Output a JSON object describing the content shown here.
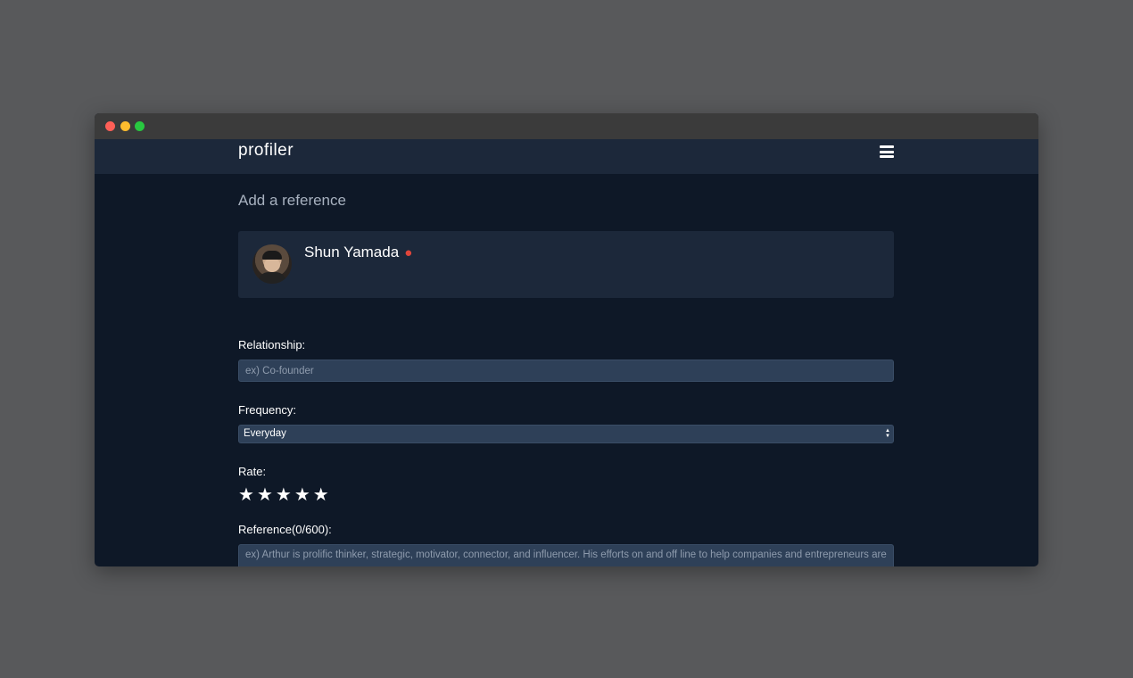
{
  "navbar": {
    "brand": "profiler"
  },
  "page": {
    "title": "Add a reference"
  },
  "profile": {
    "name": "Shun Yamada",
    "emoji_icon": "goblin-mask-icon"
  },
  "form": {
    "relationship": {
      "label": "Relationship:",
      "placeholder": "ex) Co-founder"
    },
    "frequency": {
      "label": "Frequency:",
      "selected": "Everyday"
    },
    "rate": {
      "label": "Rate:",
      "stars": 5,
      "value": 5
    },
    "reference": {
      "label": "Reference(0/600):",
      "placeholder": "ex) Arthur is prolific thinker, strategic, motivator, connector, and influencer. His efforts on and off line to help companies and entrepreneurs are"
    }
  },
  "colors": {
    "backdrop": "#58595b",
    "page_bg": "#0e1827",
    "navbar_bg": "#1c283a",
    "field_bg": "#2e4058"
  }
}
